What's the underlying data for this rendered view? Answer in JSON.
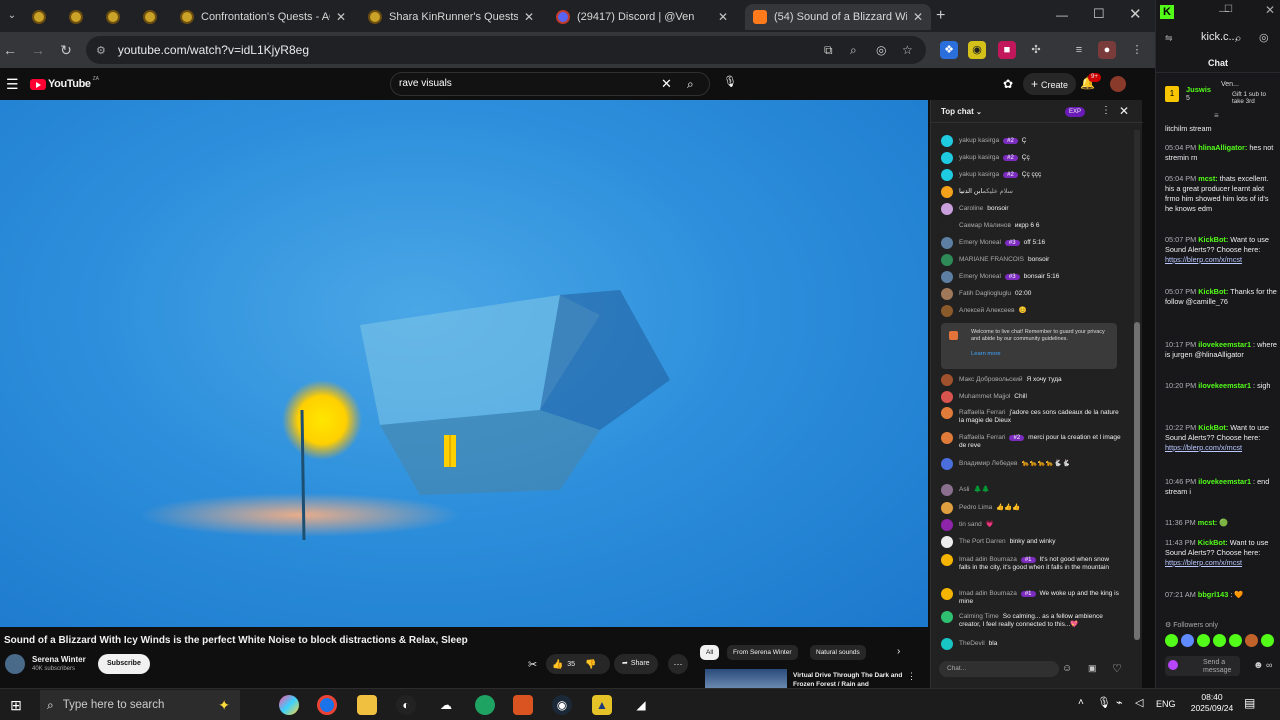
{
  "browser": {
    "tabs": [
      {
        "label": "",
        "active": false
      },
      {
        "label": "",
        "active": false
      },
      {
        "label": "",
        "active": false
      },
      {
        "label": "",
        "active": false
      },
      {
        "label": "Confrontation's Quests - AQW",
        "active": false
      },
      {
        "label": "Shara KinRunner's Quests - AQ",
        "active": false
      },
      {
        "label": "(29417) Discord | @Ven",
        "active": false
      },
      {
        "label": "(54) Sound of a Blizzard Wi",
        "active": true
      }
    ],
    "url": "youtube.com/watch?v=idL1KjyR8eg",
    "new_tab": "+"
  },
  "youtube": {
    "logo": "YouTube",
    "region": "ZA",
    "search_value": "rave visuals",
    "create_label": "Create",
    "notif_count": "9+",
    "video_title": "Sound of a Blizzard With Icy Winds is the perfect White Noise to block distractions & Relax, Sleep",
    "channel_name": "Serena Winter",
    "subscribers": "40K subscribers",
    "subscribe_label": "Subscribe",
    "likes": "35",
    "share_label": "Share",
    "chips": [
      "All",
      "From Serena Winter",
      "Natural sounds"
    ],
    "rec_title": "Virtual Drive Through The Dark and Frozen Forest / Rain and",
    "chat": {
      "header": "Top chat",
      "exp_badge": "EXP",
      "placeholder": "Chat...",
      "welcome_text": "Welcome to live chat! Remember to guard your privacy and abide by our community guidelines.",
      "learn_more": "Learn more",
      "messages_top": [
        {
          "name": "yakup kasirga",
          "badge": "#2",
          "text": "Ç",
          "color": "#1ecbe1"
        },
        {
          "name": "yakup kasirga",
          "badge": "#2",
          "text": "Çç",
          "color": "#1ecbe1"
        },
        {
          "name": "yakup kasirga",
          "badge": "#2",
          "text": "Çç ççç",
          "color": "#1ecbe1"
        },
        {
          "name": "سلام عليكم",
          "badge": "",
          "text": "ابن الدنيا",
          "color": "#f4a21b"
        },
        {
          "name": "Caroline",
          "badge": "",
          "text": "bonsoir",
          "color": "#c9a0dc"
        },
        {
          "name": "Сакмар Малинов",
          "badge": "",
          "text": "икрр 6 6",
          "color": "#222"
        },
        {
          "name": "Emery Moneal",
          "badge": "#3",
          "text": "off 5:16",
          "color": "#5c7fa3"
        },
        {
          "name": "MARIANE FRANCOIS",
          "badge": "",
          "text": "bonsoir",
          "color": "#2e8b57"
        },
        {
          "name": "Emery Moneal",
          "badge": "#3",
          "text": "bonsair 5:16",
          "color": "#5c7fa3"
        },
        {
          "name": "Fatih Dagliogluglu",
          "badge": "",
          "text": "02:00",
          "color": "#a0785a"
        },
        {
          "name": "Алексей Алексеев",
          "badge": "",
          "text": "😊",
          "color": "#8b5a2b"
        }
      ],
      "messages_bottom": [
        {
          "name": "Макс Добровольский",
          "badge": "",
          "text": "Я хочу туда",
          "color": "#a0522d"
        },
        {
          "name": "Muhammet Majjol",
          "badge": "",
          "text": "Chill",
          "color": "#d9534f"
        },
        {
          "name": "Raffaella Ferrari",
          "badge": "",
          "text": "j'adore ces sons cadeaux de la nature la magie de Dieux",
          "color": "#e07b39"
        },
        {
          "name": "Raffaella Ferrari",
          "badge": "#2",
          "text": "merci pour la creation et l image de reve",
          "color": "#e07b39"
        },
        {
          "name": "Владимир Лебедев",
          "badge": "",
          "text": "🐆🐆🐆🐆🐇🐇",
          "color": "#4a6fdc"
        },
        {
          "name": "Asli",
          "badge": "",
          "text": "🌲🌲",
          "color": "#8a6f8f"
        },
        {
          "name": "Pedro Lima",
          "badge": "",
          "text": "👍👍👍",
          "color": "#e0a040"
        },
        {
          "name": "tin sand",
          "badge": "",
          "text": "💗",
          "color": "#8e24aa"
        },
        {
          "name": "The Port Darren",
          "badge": "",
          "text": "binky and winky",
          "color": "#eee"
        },
        {
          "name": "Imad adin Boumaza",
          "badge": "#1",
          "text": "It's not good when snow falls in the city, it's good when it falls in the mountain",
          "color": "#f4b400"
        },
        {
          "name": "Imad adin Boumaza",
          "badge": "#1",
          "text": "We woke up and the king is mine",
          "color": "#f4b400"
        },
        {
          "name": "Calming Time",
          "badge": "",
          "text": "So calming... as a fellow ambience creator, I feel really connected to this...💖",
          "color": "#2fbf71"
        },
        {
          "name": "TheDevil",
          "badge": "",
          "text": "bla",
          "color": "#18c4c4"
        }
      ]
    }
  },
  "kick": {
    "url": "kick.c...",
    "chat_label": "Chat",
    "top_user": "Juswis",
    "top_count": "5",
    "gift_user": "Ven...",
    "gift_text": "Gift 1 sub to take 3rd",
    "first_line": "litchilm stream",
    "messages": [
      {
        "time": "05:04 PM",
        "user": "hlinaAlligator:",
        "text": "hes not stremin rn"
      },
      {
        "time": "05:04 PM",
        "user": "mcst:",
        "text": "thats excellent. his a great producer learnt alot frmo him showed him lots of id's he knows edm"
      },
      {
        "time": "05:07 PM",
        "user": "KickBot:",
        "text": "Want to use Sound Alerts?? Choose here:",
        "link": "https://blerp.com/x/mcst"
      },
      {
        "time": "05:07 PM",
        "user": "KickBot:",
        "text": "Thanks for the follow @camille_76"
      },
      {
        "time": "10:17 PM",
        "user": "ilovekeemstar1",
        "text": ": where is jurgen @hlinaAlligator"
      },
      {
        "time": "10:20 PM",
        "user": "ilovekeemstar1",
        "text": ": sigh"
      },
      {
        "time": "10:22 PM",
        "user": "KickBot:",
        "text": "Want to use Sound Alerts?? Choose here:",
        "link": "https://blerp.com/x/mcst"
      },
      {
        "time": "10:46 PM",
        "user": "ilovekeemstar1",
        "text": ": end stream i"
      },
      {
        "time": "11:36 PM",
        "user": "mcst:",
        "text": "🟢"
      },
      {
        "time": "11:43 PM",
        "user": "KickBot:",
        "text": "Want to use Sound Alerts?? Choose here:",
        "link": "https://blerp.com/x/mcst"
      },
      {
        "time": "07:21 AM",
        "user": "bbgrl143",
        "text": ": 🧡"
      }
    ],
    "followers_only": "Followers only",
    "send_placeholder": "Send a message"
  },
  "taskbar": {
    "search_placeholder": "Type here to search",
    "lang": "ENG",
    "time": "08:40",
    "date": "2025/09/24"
  }
}
